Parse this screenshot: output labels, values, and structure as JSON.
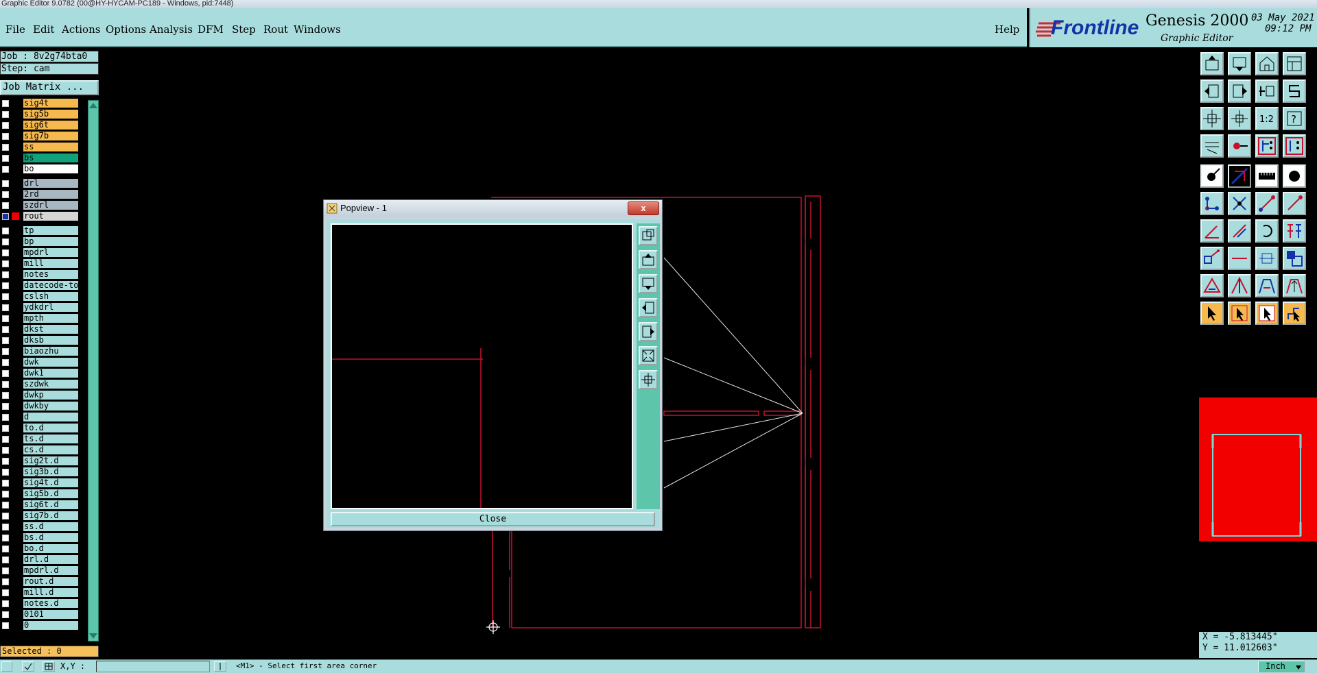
{
  "window": {
    "title": "Graphic Editor 9.0782 (00@HY-HYCAM-PC189 - Windows, pid:7448)"
  },
  "menu": {
    "items": [
      "File",
      "Edit",
      "Actions",
      "Options",
      "Analysis",
      "DFM",
      "Step",
      "Rout",
      "Windows"
    ],
    "help": "Help"
  },
  "brand": {
    "logo": "Frontline",
    "product": "Genesis 2000",
    "subtitle": "Graphic Editor",
    "date": "03 May 2021",
    "time": "09:12 PM"
  },
  "job": {
    "job_label": "Job : 8v2g74bta0",
    "step_label": "Step: cam",
    "matrix_button": "Job Matrix ..."
  },
  "layers": [
    {
      "name": "sig4t",
      "color": "#f6b94e"
    },
    {
      "name": "sig5b",
      "color": "#f6b94e"
    },
    {
      "name": "sig6t",
      "color": "#f6b94e"
    },
    {
      "name": "sig7b",
      "color": "#f6b94e"
    },
    {
      "name": "ss",
      "color": "#f6b94e"
    },
    {
      "name": "bs",
      "color": "#10a27a"
    },
    {
      "name": "bo",
      "color": "#ffffff"
    },
    {
      "name": "drl",
      "color": "#a7b8c2"
    },
    {
      "name": "2rd",
      "color": "#a7b8c2"
    },
    {
      "name": "szdrl",
      "color": "#a7b8c2"
    },
    {
      "name": "rout",
      "color": "#d6d6d6"
    },
    {
      "name": "tp",
      "color": "#a9dcdc"
    },
    {
      "name": "bp",
      "color": "#a9dcdc"
    },
    {
      "name": "mpdrl",
      "color": "#a9dcdc"
    },
    {
      "name": "mill",
      "color": "#a9dcdc"
    },
    {
      "name": "notes",
      "color": "#a9dcdc"
    },
    {
      "name": "datecode-to",
      "color": "#a9dcdc"
    },
    {
      "name": "cslsh",
      "color": "#a9dcdc"
    },
    {
      "name": "ydkdrl",
      "color": "#a9dcdc"
    },
    {
      "name": "mpth",
      "color": "#a9dcdc"
    },
    {
      "name": "dkst",
      "color": "#a9dcdc"
    },
    {
      "name": "dksb",
      "color": "#a9dcdc"
    },
    {
      "name": "biaozhu",
      "color": "#a9dcdc"
    },
    {
      "name": "dwk",
      "color": "#a9dcdc"
    },
    {
      "name": "dwk1",
      "color": "#a9dcdc"
    },
    {
      "name": "szdwk",
      "color": "#a9dcdc"
    },
    {
      "name": "dwkp",
      "color": "#a9dcdc"
    },
    {
      "name": "dwkby",
      "color": "#a9dcdc"
    },
    {
      "name": "d",
      "color": "#a9dcdc"
    },
    {
      "name": "to.d",
      "color": "#a9dcdc"
    },
    {
      "name": "ts.d",
      "color": "#a9dcdc"
    },
    {
      "name": "cs.d",
      "color": "#a9dcdc"
    },
    {
      "name": "sig2t.d",
      "color": "#a9dcdc"
    },
    {
      "name": "sig3b.d",
      "color": "#a9dcdc"
    },
    {
      "name": "sig4t.d",
      "color": "#a9dcdc"
    },
    {
      "name": "sig5b.d",
      "color": "#a9dcdc"
    },
    {
      "name": "sig6t.d",
      "color": "#a9dcdc"
    },
    {
      "name": "sig7b.d",
      "color": "#a9dcdc"
    },
    {
      "name": "ss.d",
      "color": "#a9dcdc"
    },
    {
      "name": "bs.d",
      "color": "#a9dcdc"
    },
    {
      "name": "bo.d",
      "color": "#a9dcdc"
    },
    {
      "name": "drl.d",
      "color": "#a9dcdc"
    },
    {
      "name": "mpdrl.d",
      "color": "#a9dcdc"
    },
    {
      "name": "rout.d",
      "color": "#a9dcdc"
    },
    {
      "name": "mill.d",
      "color": "#a9dcdc"
    },
    {
      "name": "notes.d",
      "color": "#a9dcdc"
    },
    {
      "name": "0101",
      "color": "#a9dcdc"
    },
    {
      "name": "0",
      "color": "#a9dcdc"
    }
  ],
  "selected": "Selected : 0",
  "popup": {
    "title": "Popview - 1",
    "close_x": "x",
    "close_button": "Close"
  },
  "coordinates": {
    "x": "X = -5.813445\"",
    "y": "Y = 11.012603\""
  },
  "status": {
    "xy_label": "X,Y :",
    "prompt": "<M1> - Select first area corner",
    "units": "Inch"
  }
}
